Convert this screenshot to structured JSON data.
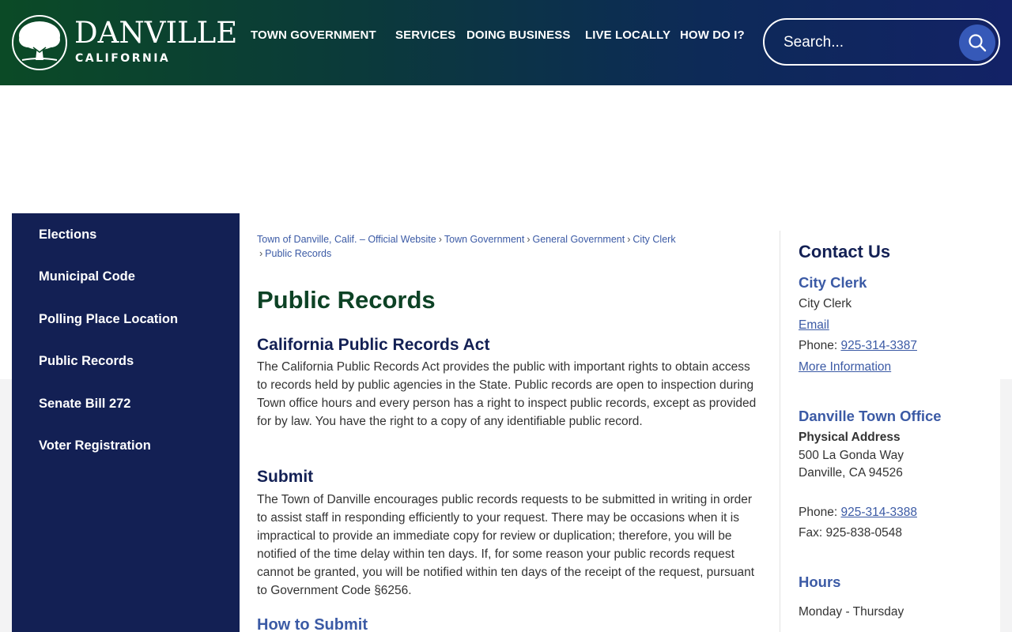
{
  "header": {
    "logo_name": "DANVILLE",
    "logo_sub": "CALIFORNIA",
    "nav": [
      "TOWN GOVERNMENT",
      "SERVICES",
      "DOING BUSINESS",
      "LIVE LOCALLY",
      "HOW DO I?"
    ],
    "search_placeholder": "Search..."
  },
  "sidebar": {
    "items": [
      "Elections",
      "Municipal Code",
      "Polling Place Location",
      "Public Records",
      "Senate Bill 272",
      "Voter Registration"
    ]
  },
  "breadcrumb": [
    "Town of Danville, Calif. – Official Website",
    "Town Government",
    "General Government",
    "City Clerk",
    "Public Records"
  ],
  "main": {
    "title": "Public Records",
    "section1_heading": "California Public Records Act",
    "section1_text": "The California Public Records Act provides the public with important rights to obtain access to records held by public agencies in the State. Public records are open to inspection during Town office hours and every person has a right to inspect public records, except as provided for by law. You have the right to a copy of any identifiable public record.",
    "section2_heading": "Submit",
    "section2_text": "The Town of Danville encourages public records requests to be submitted in writing in order to assist staff in responding efficiently to your request. There may be occasions when it is impractical to provide an immediate copy for review or duplication; therefore, you will be notified of the time delay within ten days. If, for some reason your public records request cannot be granted, you will be notified within ten days of the receipt of the request, pursuant to Government Code §6256.",
    "section3_heading": "How to Submit"
  },
  "contact": {
    "title": "Contact Us",
    "clerk_heading": "City Clerk",
    "clerk_name": "City Clerk",
    "email_label": "Email",
    "phone_label": "Phone:",
    "clerk_phone": "925-314-3387",
    "more_info": "More Information",
    "office_heading": "Danville Town Office",
    "address_label": "Physical Address",
    "address_line1": "500 La Gonda Way",
    "address_line2": "Danville, CA 94526",
    "office_phone_label": "Phone:",
    "office_phone": "925-314-3388",
    "fax": "Fax: 925-838-0548",
    "hours_heading": "Hours",
    "hours_days": "Monday - Thursday"
  },
  "colors": {
    "header_green": "#0b4a26",
    "header_navy": "#132266",
    "sidebar_bg": "#132054",
    "title_green": "#0d4225",
    "link_blue": "#3b5aa5"
  }
}
